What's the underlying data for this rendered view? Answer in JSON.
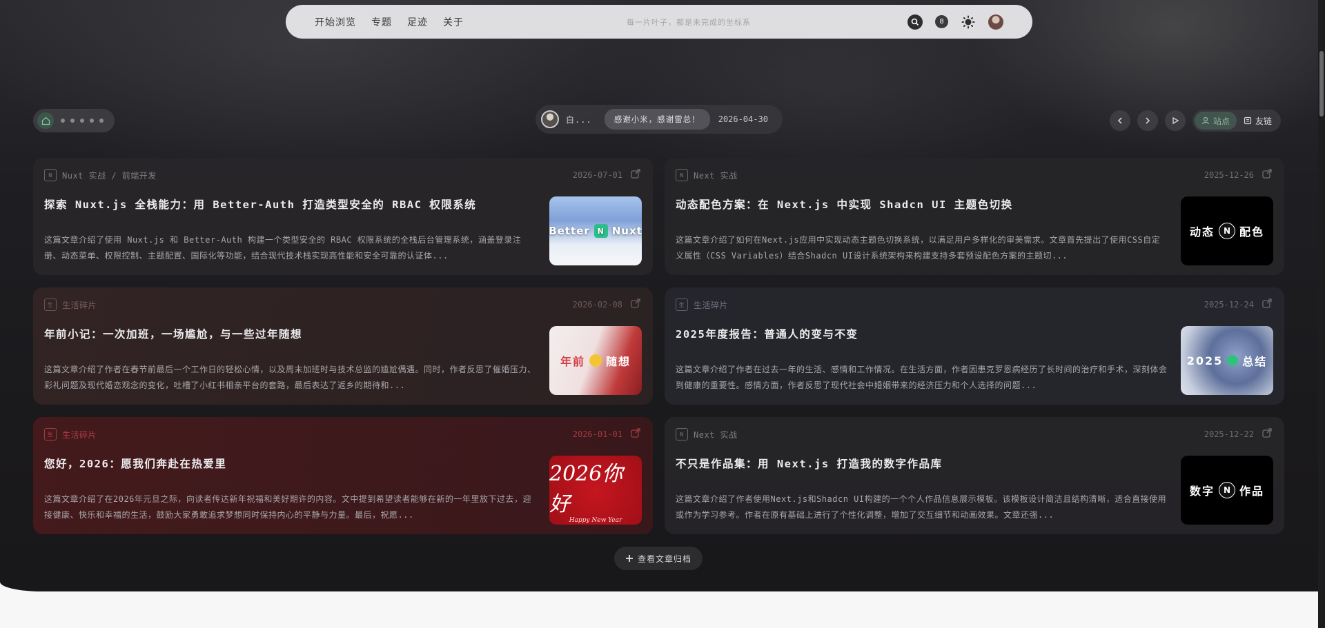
{
  "nav": {
    "links": [
      "开始浏览",
      "专题",
      "足迹",
      "关于"
    ],
    "search_placeholder": "每一片叶子，都是未完成的坐标系",
    "notification_count": "8"
  },
  "toolbar": {
    "speaker_name": "白...",
    "message": "感谢小米，感谢雷总！",
    "message_date": "2026-04-30",
    "tab_site": "站点",
    "tab_links": "友链"
  },
  "cards": [
    {
      "category": "Nuxt 实战 / 前端开发",
      "date": "2026-07-01",
      "title": "探索 Nuxt.js 全栈能力：用 Better-Auth 打造类型安全的 RBAC 权限系统",
      "desc": "这篇文章介绍了使用 Nuxt.js 和 Better-Auth 构建一个类型安全的 RBAC 权限系统的全栈后台管理系统，涵盖登录注册、动态菜单、权限控制、主题配置、国际化等功能，结合现代技术栈实现高性能和安全可靠的认证体...",
      "thumb_left": "Better",
      "thumb_right": "Nuxt"
    },
    {
      "category": "Next 实战",
      "date": "2025-12-26",
      "title": "动态配色方案：在 Next.js 中实现 Shadcn UI 主题色切换",
      "desc": "这篇文章介绍了如何在Next.js应用中实现动态主题色切换系统，以满足用户多样化的审美需求。文章首先提出了使用CSS自定义属性（CSS Variables）结合Shadcn UI设计系统架构来构建支持多套预设配色方案的主题切...",
      "thumb_left": "动态",
      "thumb_right": "配色"
    },
    {
      "category": "生活碎片",
      "date": "2026-02-08",
      "title": "年前小记：一次加班，一场尴尬，与一些过年随想",
      "desc": "这篇文章介绍了作者在春节前最后一个工作日的轻松心情，以及周末加班时与技术总监的尴尬偶遇。同时，作者反思了催婚压力、彩礼问题及现代婚恋观念的变化，吐槽了小红书相亲平台的套路，最后表达了返乡的期待和...",
      "thumb_left": "年前",
      "thumb_right": "随想"
    },
    {
      "category": "生活碎片",
      "date": "2025-12-24",
      "title": "2025年度报告：普通人的变与不变",
      "desc": "这篇文章介绍了作者在过去一年的生活、感情和工作情况。在生活方面，作者因患克罗恩病经历了长时间的治疗和手术，深刻体会到健康的重要性。感情方面，作者反思了现代社会中婚姻带来的经济压力和个人选择的问题...",
      "thumb_left": "2025",
      "thumb_right": "总结"
    },
    {
      "category": "生活碎片",
      "date": "2026-01-01",
      "title": "您好，2026：愿我们奔赴在热爱里",
      "desc": "这篇文章介绍了在2026年元旦之际，向读者传达新年祝福和美好期许的内容。文中提到希望读者能够在新的一年里放下过去，迎接健康、快乐和幸福的生活，鼓励大家勇敢追求梦想同时保持内心的平静与力量。最后，祝愿...",
      "thumb_left": "2026你好",
      "thumb_right": "Happy New Year"
    },
    {
      "category": "Next 实战",
      "date": "2025-12-22",
      "title": "不只是作品集：用 Next.js 打造我的数字作品库",
      "desc": "这篇文章介绍了作者使用Next.js和Shadcn UI构建的一个个人作品信息展示模板。该模板设计简洁且结构清晰，适合直接使用或作为学习参考。作者在原有基础上进行了个性化调整，增加了交互细节和动画效果。文章还强...",
      "thumb_left": "数字",
      "thumb_right": "作品"
    }
  ],
  "archive_label": "查看文章归档",
  "colors": {
    "accent_green": "#8fb9a2",
    "red_accent": "#c0393c"
  }
}
